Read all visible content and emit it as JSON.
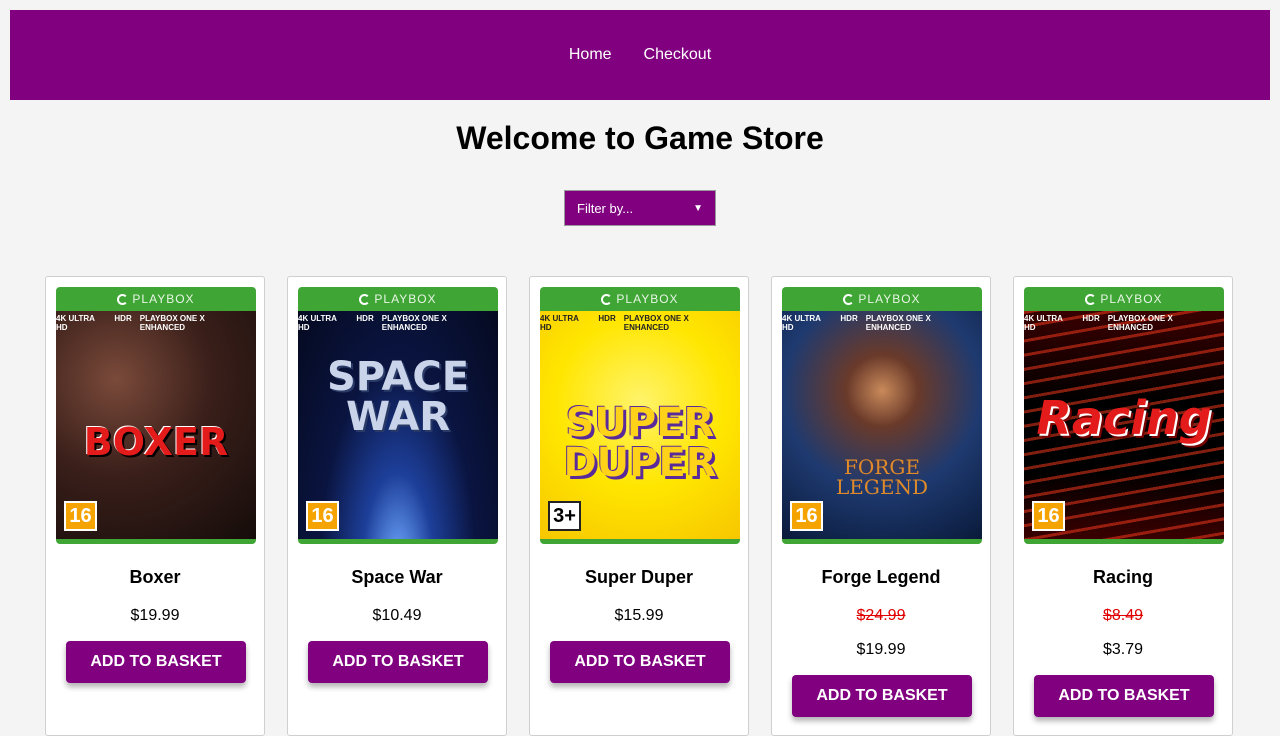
{
  "nav": {
    "items": [
      "Home",
      "Checkout"
    ]
  },
  "page": {
    "title": "Welcome to Game Store"
  },
  "filter": {
    "selected": "Filter by..."
  },
  "cover_brand": "PLAYBOX",
  "cover_badges": [
    "4K ULTRA HD",
    "HDR",
    "PLAYBOX ONE X ENHANCED"
  ],
  "products": [
    {
      "name": "Boxer",
      "price": "$19.99",
      "rating": "16",
      "cover_title": "BOXER",
      "button": "ADD TO BASKET"
    },
    {
      "name": "Space War",
      "price": "$10.49",
      "rating": "16",
      "cover_title": "SPACE WAR",
      "button": "ADD TO BASKET"
    },
    {
      "name": "Super Duper",
      "price": "$15.99",
      "rating": "3+",
      "cover_title": "SUPER DUPER",
      "button": "ADD TO BASKET"
    },
    {
      "name": "Forge Legend",
      "old_price": "$24.99",
      "price": "$19.99",
      "rating": "16",
      "cover_title": "FORGE LEGEND",
      "button": "ADD TO BASKET"
    },
    {
      "name": "Racing",
      "old_price": "$8.49",
      "price": "$3.79",
      "rating": "16",
      "cover_title": "Racing",
      "button": "ADD TO BASKET"
    }
  ],
  "colors": {
    "accent": "#800080",
    "cover_green": "#3fa535",
    "sale_red": "#e00000"
  }
}
